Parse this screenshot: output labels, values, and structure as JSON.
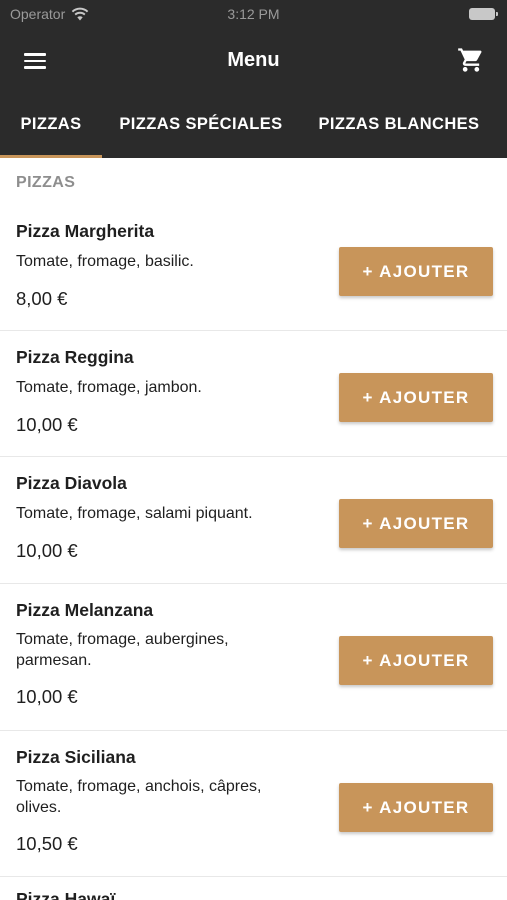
{
  "status_bar": {
    "carrier": "Operator",
    "time": "3:12 PM"
  },
  "header": {
    "title": "Menu"
  },
  "tabs": [
    {
      "label": "PIZZAS",
      "active": true
    },
    {
      "label": "PIZZAS SPÉCIALES",
      "active": false
    },
    {
      "label": "PIZZAS BLANCHES",
      "active": false
    }
  ],
  "section": {
    "title": "PIZZAS"
  },
  "items": [
    {
      "name": "Pizza Margherita",
      "description": "Tomate, fromage, basilic.",
      "price": "8,00 €",
      "button": "+ AJOUTER"
    },
    {
      "name": "Pizza Reggina",
      "description": "Tomate, fromage, jambon.",
      "price": "10,00 €",
      "button": "+ AJOUTER"
    },
    {
      "name": "Pizza Diavola",
      "description": "Tomate, fromage, salami piquant.",
      "price": "10,00 €",
      "button": "+ AJOUTER"
    },
    {
      "name": "Pizza Melanzana",
      "description": "Tomate, fromage, aubergines, parmesan.",
      "price": "10,00 €",
      "button": "+ AJOUTER"
    },
    {
      "name": "Pizza Siciliana",
      "description": "Tomate, fromage, anchois, câpres, olives.",
      "price": "10,50 €",
      "button": "+ AJOUTER"
    },
    {
      "name": "Pizza Hawaï",
      "description": "",
      "price": "",
      "button": ""
    }
  ],
  "colors": {
    "bar": "#2b2b2b",
    "accent": "#c8955a",
    "section_title": "#8e8e8e"
  },
  "icons": {
    "menu": "hamburger-menu-icon",
    "cart": "shopping-cart-icon",
    "wifi": "wifi-icon",
    "battery": "battery-icon"
  }
}
